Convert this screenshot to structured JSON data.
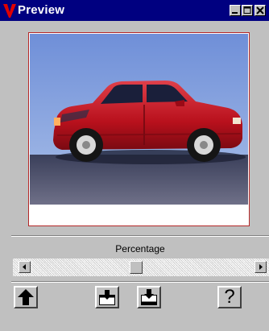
{
  "window": {
    "title": "Preview",
    "app_icon": "v-logo-icon",
    "controls": [
      "minimize-icon",
      "maximize-icon",
      "close-icon"
    ]
  },
  "preview": {
    "image_subject": "red car"
  },
  "zoom": {
    "label": "Percentage",
    "slider_position": 0.47
  },
  "toolbar": {
    "buttons": [
      {
        "name": "up-arrow-button",
        "icon": "up-arrow-icon"
      },
      {
        "name": "import-button",
        "icon": "tray-down-icon"
      },
      {
        "name": "export-button",
        "icon": "tray-down-icon"
      },
      {
        "name": "help-button",
        "icon": "question-icon",
        "label": "?"
      }
    ]
  },
  "colors": {
    "title_bar": "#000080",
    "face": "#c0c0c0",
    "frame_border": "#b42828",
    "logo": "#e00000"
  }
}
